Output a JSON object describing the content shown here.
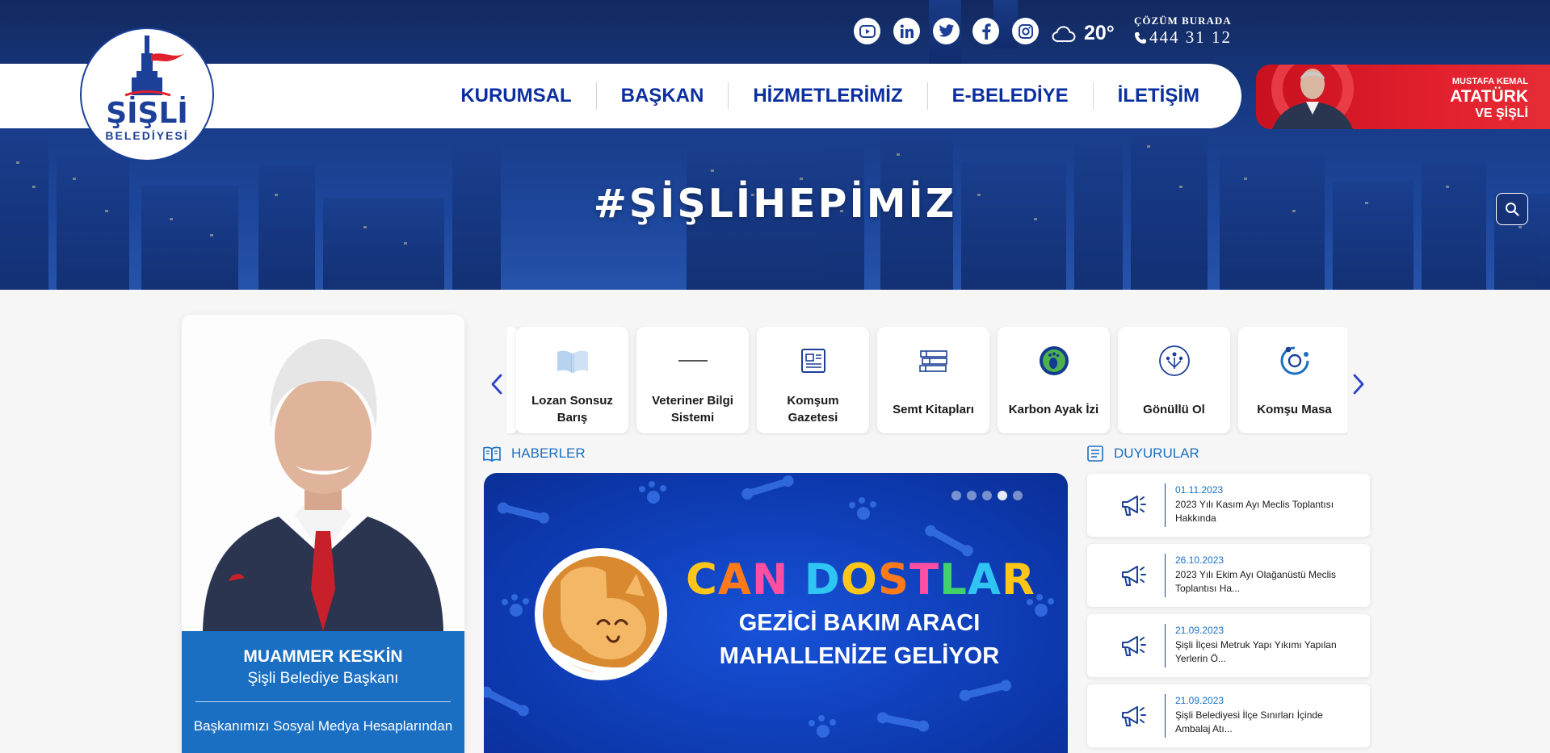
{
  "brand": {
    "logo_main": "ŞİŞLİ",
    "logo_sub": "BELEDİYESİ"
  },
  "topbar": {
    "social": [
      "youtube-icon",
      "linkedin-icon",
      "twitter-icon",
      "facebook-icon",
      "instagram-icon"
    ],
    "weather_icon": "cloud-icon",
    "temperature": "20°",
    "hotline_label": "ÇÖZÜM BURADA",
    "hotline_number": "444 31 12"
  },
  "nav": {
    "items": [
      "KURUMSAL",
      "BAŞKAN",
      "HİZMETLERİMİZ",
      "E-BELEDİYE",
      "İLETİŞİM"
    ]
  },
  "ataturk": {
    "line1": "MUSTAFA KEMAL",
    "line2": "ATATÜRK",
    "line3": "VE ŞİŞLİ"
  },
  "hero": {
    "title": "#ŞİŞLİHEPİMİZ"
  },
  "mayor": {
    "name": "MUAMMER KESKİN",
    "role": "Şişli Belediye Başkanı",
    "social_text": "Başkanımızı Sosyal Medya Hesaplarından"
  },
  "services": [
    {
      "label": "Lozan Sonsuz Barış",
      "icon": "book-icon"
    },
    {
      "label": "Veteriner Bilgi Sistemi",
      "icon": "vet-logo-icon"
    },
    {
      "label": "Komşum Gazetesi",
      "icon": "newspaper-icon"
    },
    {
      "label": "Semt Kitapları",
      "icon": "books-icon"
    },
    {
      "label": "Karbon Ayak İzi",
      "icon": "footprint-icon"
    },
    {
      "label": "Gönüllü Ol",
      "icon": "volunteer-icon"
    },
    {
      "label": "Komşu Masa",
      "icon": "table-icon"
    }
  ],
  "news": {
    "header": "HABERLER",
    "slide_title": "CAN DOSTLAR",
    "slide_line1": "GEZİCİ BAKIM ARACI",
    "slide_line2": "MAHALLENİZE GELİYOR",
    "slide_count": 5,
    "active_slide": 4
  },
  "announcements": {
    "header": "DUYURULAR",
    "items": [
      {
        "date": "01.11.2023",
        "text": "2023 Yılı Kasım Ayı Meclis Toplantısı Hakkında"
      },
      {
        "date": "26.10.2023",
        "text": "2023 Yılı Ekim Ayı Olağanüstü Meclis Toplantısı Ha..."
      },
      {
        "date": "21.09.2023",
        "text": "Şişli İlçesi Metruk Yapı Yıkımı Yapılan Yerlerin Ö..."
      },
      {
        "date": "21.09.2023",
        "text": "Şişli Belediyesi İlçe Sınırları İçinde Ambalaj Atı..."
      }
    ]
  },
  "colors": {
    "brand_blue": "#0b2f9f",
    "accent_blue": "#1b6fc2",
    "ataturk_red": "#e2202d"
  }
}
